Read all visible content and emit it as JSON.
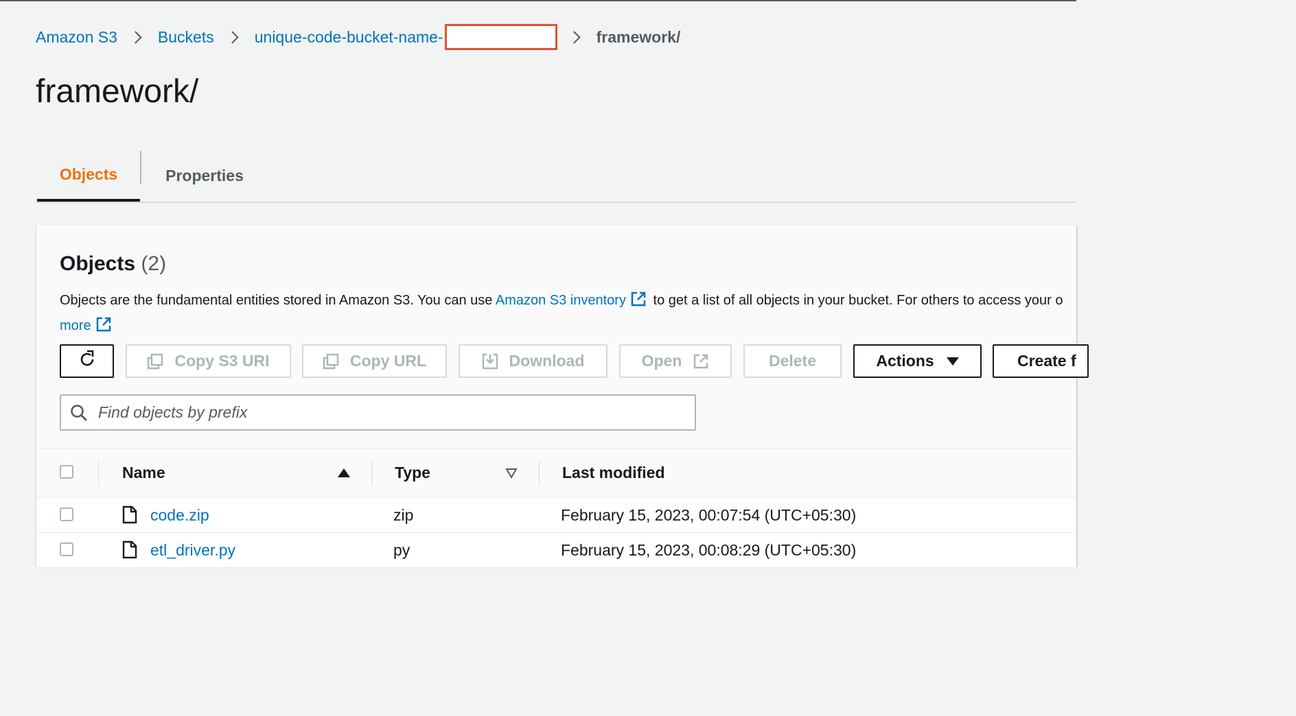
{
  "breadcrumb": {
    "items": [
      {
        "label": "Amazon S3"
      },
      {
        "label": "Buckets"
      },
      {
        "label": "unique-code-bucket-name-"
      }
    ],
    "current": "framework/"
  },
  "page": {
    "title": "framework/"
  },
  "tabs": [
    {
      "label": "Objects",
      "active": true
    },
    {
      "label": "Properties",
      "active": false
    }
  ],
  "objects_panel": {
    "title": "Objects",
    "count": "(2)",
    "description_before": "Objects are the fundamental entities stored in Amazon S3. You can use ",
    "description_link": "Amazon S3 inventory",
    "description_after": " to get a list of all objects in your bucket. For others to access your o",
    "learn_more": "more"
  },
  "toolbar": {
    "copy_s3_uri": "Copy S3 URI",
    "copy_url": "Copy URL",
    "download": "Download",
    "open": "Open",
    "delete": "Delete",
    "actions": "Actions",
    "create": "Create f"
  },
  "search": {
    "placeholder": "Find objects by prefix"
  },
  "table": {
    "columns": {
      "name": "Name",
      "type": "Type",
      "last_modified": "Last modified"
    },
    "rows": [
      {
        "name": "code.zip",
        "type": "zip",
        "last_modified": "February 15, 2023, 00:07:54 (UTC+05:30)"
      },
      {
        "name": "etl_driver.py",
        "type": "py",
        "last_modified": "February 15, 2023, 00:08:29 (UTC+05:30)"
      }
    ]
  },
  "colors": {
    "link": "#0073bb",
    "accent": "#ec7211",
    "redaction": "#e0522e"
  }
}
